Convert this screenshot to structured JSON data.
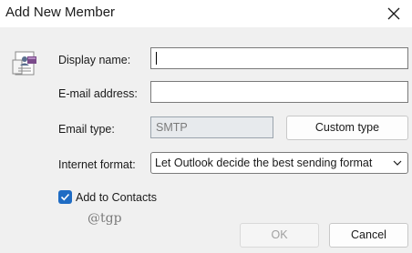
{
  "dialog": {
    "title": "Add New Member",
    "close_icon": "close-icon",
    "contact_icon": "contact-card-icon"
  },
  "form": {
    "display_name": {
      "label": "Display name:",
      "value": ""
    },
    "email_address": {
      "label": "E-mail address:",
      "value": ""
    },
    "email_type": {
      "label": "Email type:",
      "value": "SMTP"
    },
    "custom_type_button": "Custom type",
    "internet_format": {
      "label": "Internet format:",
      "selected": "Let Outlook decide the best sending format"
    },
    "add_to_contacts": {
      "label": "Add to Contacts",
      "checked": true
    }
  },
  "watermark": "@tgp",
  "buttons": {
    "ok": "OK",
    "cancel": "Cancel"
  },
  "colors": {
    "accent": "#1f6cc4",
    "background": "#f0f0f0",
    "titlebar": "#ffffff"
  }
}
